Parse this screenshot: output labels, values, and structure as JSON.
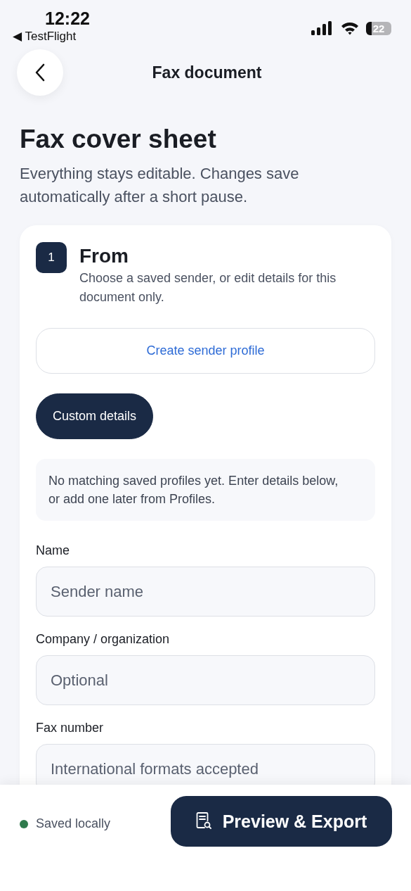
{
  "status_bar": {
    "time": "12:22",
    "back_app": "◀ TestFlight",
    "battery": "22"
  },
  "header": {
    "title": "Fax document"
  },
  "page": {
    "title": "Fax cover sheet",
    "subtitle": "Everything stays editable. Changes save automatically after a short pause."
  },
  "section": {
    "step": "1",
    "title": "From",
    "description": "Choose a saved sender, or edit details for this document only.",
    "create_button": "Create sender profile",
    "options": [
      {
        "label": "Custom details",
        "selected": true
      }
    ],
    "notice": "No matching saved profiles yet. Enter details below, or add one later from Profiles.",
    "fields": [
      {
        "label": "Name",
        "placeholder": "Sender name"
      },
      {
        "label": "Company / organization",
        "placeholder": "Optional"
      },
      {
        "label": "Fax number",
        "placeholder": "International formats accepted"
      }
    ]
  },
  "footer": {
    "status": "Saved locally",
    "button": "Preview & Export"
  }
}
